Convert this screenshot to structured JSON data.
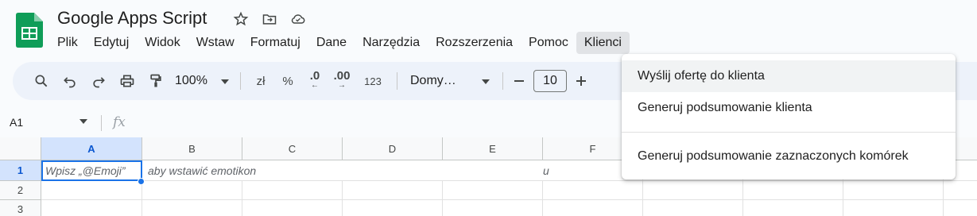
{
  "doc": {
    "title": "Google Apps Script"
  },
  "menubar": [
    "Plik",
    "Edytuj",
    "Widok",
    "Wstaw",
    "Formatuj",
    "Dane",
    "Narzędzia",
    "Rozszerzenia",
    "Pomoc",
    "Klienci"
  ],
  "toolbar": {
    "zoom": "100%",
    "currency": "zł",
    "percent": "%",
    "decrease_decimal": ".0",
    "increase_decimal": ".00",
    "number_format": "123",
    "font": "Domy…",
    "font_size": "10"
  },
  "formula_bar": {
    "name_box": "A1",
    "fx": "fx"
  },
  "grid": {
    "columns": [
      "A",
      "B",
      "C",
      "D",
      "E",
      "F"
    ],
    "rows": [
      "1",
      "2",
      "3"
    ],
    "cells": {
      "a1": "Wpisz „@Emoji”",
      "b1": "aby wstawić emotikon",
      "f1": "u"
    }
  },
  "dropdown": {
    "items": [
      "Wyślij ofertę do klienta",
      "Generuj podsumowanie klienta",
      "Generuj podsumowanie zaznaczonych komórek"
    ]
  },
  "colors": {
    "sheets_green": "#0f9d58",
    "selection_blue": "#1a73e8",
    "toolbar_bg": "#edf2fa"
  }
}
